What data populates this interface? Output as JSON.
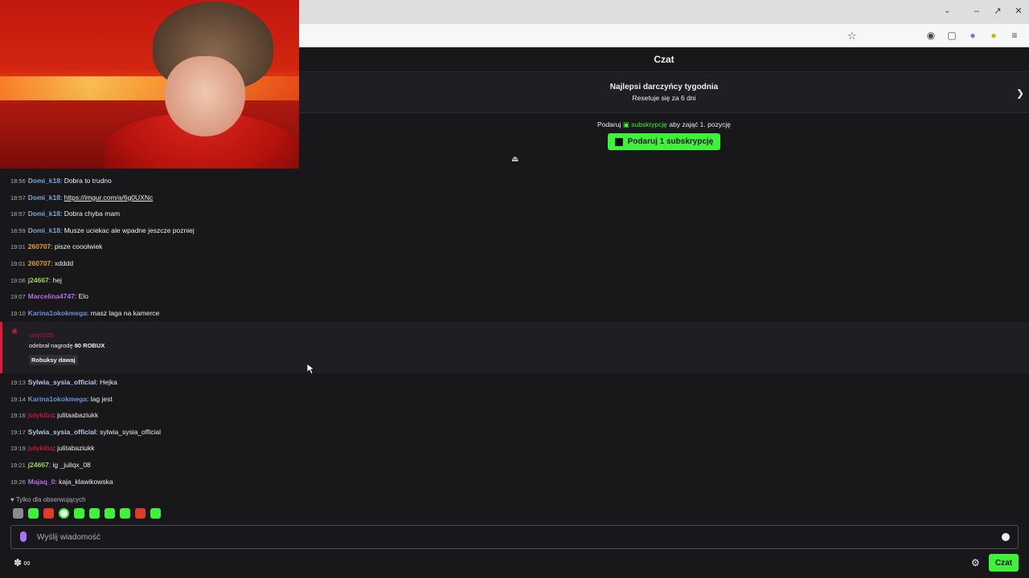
{
  "colors": {
    "accent_green": "#3df239",
    "background": "#18181b",
    "reward_highlight": "#e3183a"
  },
  "chat": {
    "title": "Czat",
    "top_gifters": {
      "title": "Najlepsi darczyńcy tygodnia",
      "reset": "Resetuje się za 6 dni"
    },
    "gift_prompt": {
      "prefix": "Podaruj",
      "highlight": "subskrypcję",
      "suffix": "aby zająć 1. pozycję",
      "button_label": "Podaruj 1 subskrypcję"
    },
    "messages_before": [
      {
        "time": "18:56",
        "user": "Domi_k18",
        "color": "#7aa5d9",
        "text": "Dobra to trudno"
      },
      {
        "time": "18:57",
        "user": "Domi_k18",
        "color": "#7aa5d9",
        "text": "https://imgur.com/a/6g0UXNc",
        "is_link": true
      },
      {
        "time": "18:57",
        "user": "Domi_k18",
        "color": "#7aa5d9",
        "text": "Dobra chyba mam"
      },
      {
        "time": "18:59",
        "user": "Domi_k18",
        "color": "#7aa5d9",
        "text": "Musze uciekac ale wpadne jeszcze pozniej"
      },
      {
        "time": "19:01",
        "user": "260707",
        "color": "#e0a02a",
        "text": "pisze cooolwiek"
      },
      {
        "time": "19:01",
        "user": "260707",
        "color": "#e0a02a",
        "text": "xdddd"
      },
      {
        "time": "19:06",
        "user": "j24667",
        "color": "#9ad35a",
        "text": "hej"
      },
      {
        "time": "19:07",
        "user": "Marcelina4747",
        "color": "#b36ee0",
        "text": "Elo"
      },
      {
        "time": "19:10",
        "user": "Karina1okokmega",
        "color": "#6f8fd8",
        "text": "masz laga na kamerce"
      }
    ],
    "reward": {
      "user": "stay2025",
      "text_prefix": "odebrał nagrodę",
      "reward_name": "80 ROBUX",
      "tag": "Robuksy dawaj"
    },
    "messages_after": [
      {
        "time": "19:13",
        "user": "Sylwia_sysia_official",
        "color": "#b8c6e8",
        "text": "Hejka"
      },
      {
        "time": "19:14",
        "user": "Karina1okokmega",
        "color": "#6f8fd8",
        "text": "lag jest"
      },
      {
        "time": "19:16",
        "user": "julykiba",
        "color": "#c2143a",
        "text": "julitaabaziukk"
      },
      {
        "time": "19:17",
        "user": "Sylwia_sysia_official",
        "color": "#b8c6e8",
        "text": "sylwia_sysia_official"
      },
      {
        "time": "19:19",
        "user": "julykiba",
        "color": "#c2143a",
        "text": "julitabaziukk"
      },
      {
        "time": "19:21",
        "user": "j24667",
        "color": "#9ad35a",
        "text": "ig _juliqx_08"
      },
      {
        "time": "19:26",
        "user": "Majaq_0",
        "color": "#b36ee0",
        "text": "kaja_klawikowska"
      }
    ],
    "followers_only": "Tylko dla obserwujących",
    "input_placeholder": "Wyślij wiadomość",
    "send_button": "Czat"
  }
}
